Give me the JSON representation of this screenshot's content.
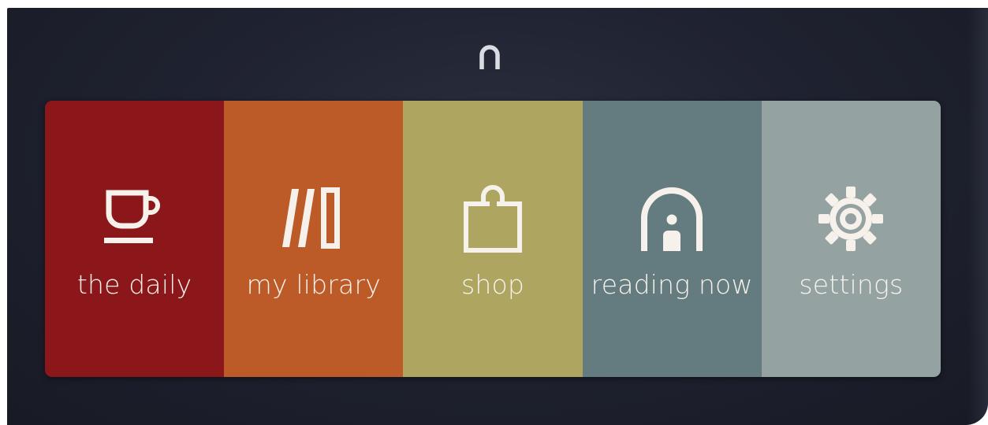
{
  "colors": {
    "device_bezel": "#1f2230",
    "nook_button": "#d9dde3",
    "icon_and_text": "#f6f1ea"
  },
  "nook_button": {
    "icon": "nook-n-icon"
  },
  "menu": {
    "tiles": [
      {
        "label": "the daily",
        "icon": "coffee-cup-icon",
        "color": "#8b171b"
      },
      {
        "label": "my library",
        "icon": "library-books-icon",
        "color": "#bc5b28"
      },
      {
        "label": "shop",
        "icon": "shopping-bag-icon",
        "color": "#ada560"
      },
      {
        "label": "reading now",
        "icon": "reading-arch-icon",
        "color": "#647b80"
      },
      {
        "label": "settings",
        "icon": "gear-icon",
        "color": "#95a2a2"
      }
    ]
  }
}
